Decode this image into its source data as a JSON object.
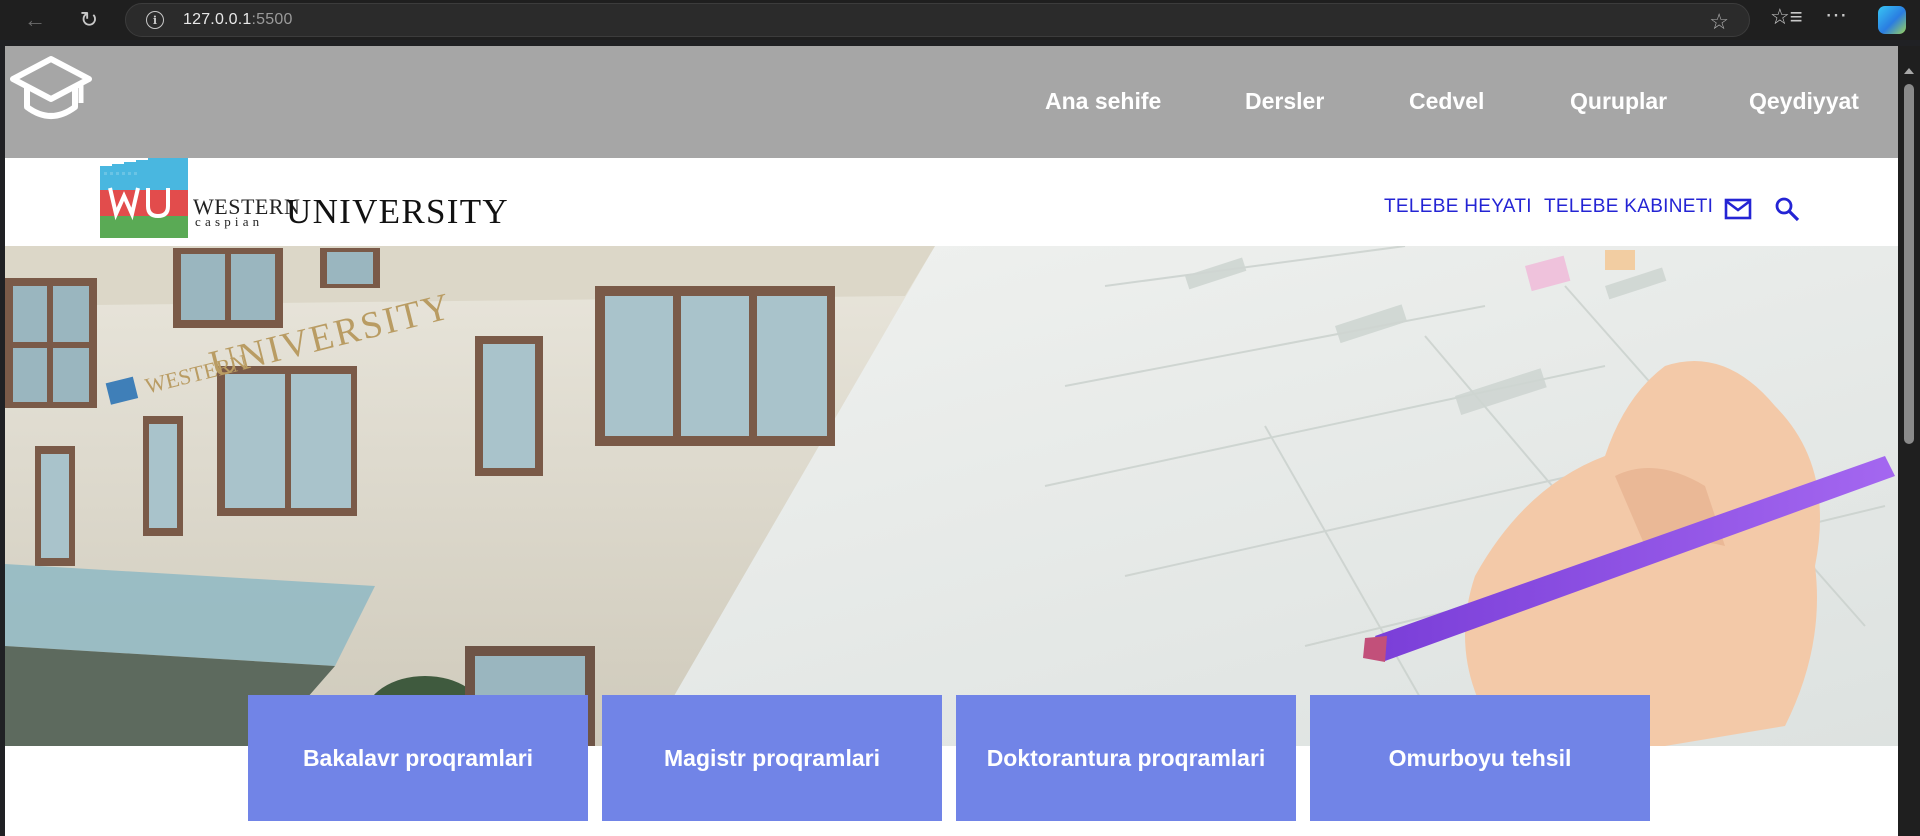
{
  "browser": {
    "url_host": "127.0.0.1",
    "url_port": ":5500",
    "icons": [
      "back-arrow-icon",
      "reload-icon",
      "info-icon",
      "star-icon",
      "favorites-icon",
      "more-icon",
      "copilot-icon"
    ]
  },
  "nav": {
    "items": [
      {
        "label": "Ana sehife"
      },
      {
        "label": "Dersler"
      },
      {
        "label": "Cedvel"
      },
      {
        "label": "Quruplar"
      },
      {
        "label": "Qeydiyyat"
      }
    ]
  },
  "header": {
    "logo_western": "WESTERN",
    "logo_caspian": "caspian",
    "logo_university": "UNIVERSITY",
    "links": [
      {
        "label": "TELEBE HEYATI"
      },
      {
        "label": "TELEBE KABINETI"
      }
    ]
  },
  "hero": {
    "sign_western": "WESTERN",
    "sign_university": "UNIVERSITY"
  },
  "programs": [
    {
      "label": "Bakalavr proqramlari"
    },
    {
      "label": "Magistr proqramlari"
    },
    {
      "label": "Doktorantura proqramlari"
    },
    {
      "label": "Omurboyu tehsil"
    }
  ],
  "colors": {
    "nav_bg": "#a6a6a6",
    "card_bg": "#7184e7",
    "header_link": "#2424d4"
  }
}
